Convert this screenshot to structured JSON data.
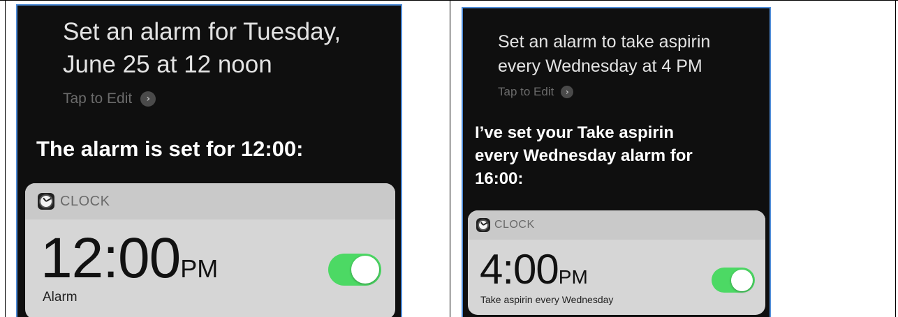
{
  "left": {
    "query_line1": "Set an alarm for Tuesday,",
    "query_line2": "June 25 at 12 noon",
    "tap_to_edit": "Tap to Edit",
    "response": "The alarm is set for 12:00:",
    "card": {
      "app_name": "CLOCK",
      "app_icon": "clock-icon",
      "time": "12:00",
      "ampm": "PM",
      "label": "Alarm",
      "toggle_on": true
    }
  },
  "right": {
    "query_line1": "Set an alarm to take aspirin",
    "query_line2": "every Wednesday at 4 PM",
    "tap_to_edit": "Tap to Edit",
    "response_line1": "I’ve set your Take aspirin",
    "response_line2": "every Wednesday alarm for",
    "response_line3": "16:00:",
    "card": {
      "app_name": "CLOCK",
      "app_icon": "clock-icon",
      "time": "4:00",
      "ampm": "PM",
      "label": "Take aspirin every Wednesday",
      "toggle_on": true
    }
  },
  "colors": {
    "background": "#0f0f0f",
    "toggle_on": "#4cd964",
    "card": "#d6d6d6",
    "card_header": "#c9c9c9",
    "border_accent": "#4f8dd9"
  }
}
